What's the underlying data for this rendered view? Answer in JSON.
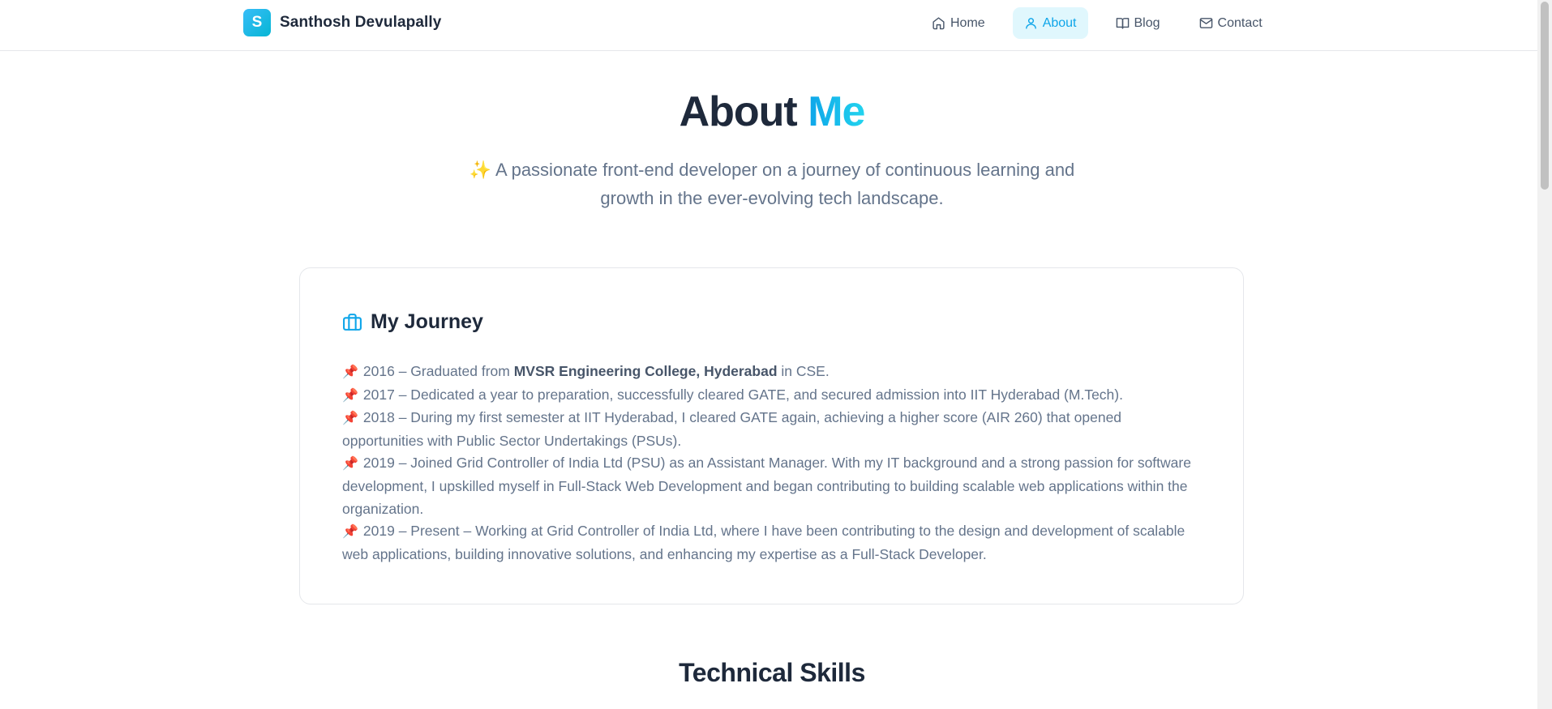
{
  "brand": {
    "logo_letter": "S",
    "name": "Santhosh Devulapally"
  },
  "nav": {
    "items": [
      {
        "label": "Home",
        "icon": "home-icon"
      },
      {
        "label": "About",
        "icon": "user-icon",
        "active": true
      },
      {
        "label": "Blog",
        "icon": "book-icon"
      },
      {
        "label": "Contact",
        "icon": "mail-icon"
      }
    ]
  },
  "hero": {
    "title_main": "About",
    "title_accent": "Me",
    "subtitle_emoji": "✨",
    "subtitle": "A passionate front-end developer on a journey of continuous learning and growth in the ever-evolving tech landscape."
  },
  "journey": {
    "title": "My Journey",
    "icon": "briefcase-icon",
    "entries": [
      {
        "pin": "📌",
        "pre": "2016 – Graduated from ",
        "bold": "MVSR Engineering College, Hyderabad",
        "post": " in CSE."
      },
      {
        "pin": "📌",
        "text": "2017 – Dedicated a year to preparation, successfully cleared GATE, and secured admission into IIT Hyderabad (M.Tech)."
      },
      {
        "pin": "📌",
        "text": "2018 – During my first semester at IIT Hyderabad, I cleared GATE again, achieving a higher score (AIR 260) that opened opportunities with Public Sector Undertakings (PSUs)."
      },
      {
        "pin": "📌",
        "text": "2019 – Joined Grid Controller of India Ltd (PSU) as an Assistant Manager. With my IT background and a strong passion for software development, I upskilled myself in Full-Stack Web Development and began contributing to building scalable web applications within the organization."
      },
      {
        "pin": "📌",
        "text": "2019 – Present – Working at Grid Controller of India Ltd, where I have been contributing to the design and development of scalable web applications, building innovative solutions, and enhancing my expertise as a Full-Stack Developer."
      }
    ]
  },
  "skills": {
    "title": "Technical Skills"
  },
  "colors": {
    "accent": "#0ea5e9",
    "active_bg": "#e0f7fd",
    "text": "#1e293b",
    "muted": "#64748b"
  }
}
